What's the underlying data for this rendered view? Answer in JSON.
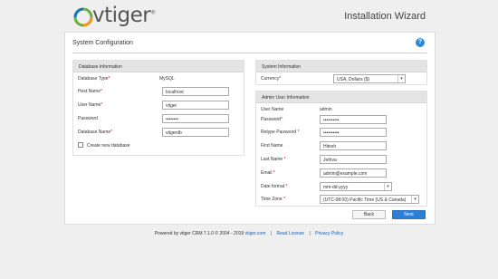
{
  "brand": {
    "name": "vtiger",
    "trademark": "®"
  },
  "header": {
    "wizard_title": "Installation Wizard"
  },
  "page": {
    "title": "System Configuration",
    "help_icon": "help-icon"
  },
  "database": {
    "heading": "Database Information",
    "fields": [
      {
        "label": "Database Type",
        "required": "*",
        "value": "MySQL"
      },
      {
        "label": "Host Name",
        "required": "*",
        "value": "localhost"
      },
      {
        "label": "User Name",
        "required": "*",
        "value": "vtiger"
      },
      {
        "label": "Password",
        "required": "",
        "value": "••••••••"
      },
      {
        "label": "Database Name",
        "required": "*",
        "value": "vtigerdb"
      }
    ],
    "create_new_label": "Create new database"
  },
  "system": {
    "heading": "System Information",
    "currency_label": "Currency",
    "currency_required": "*",
    "currency_value": "USA, Dollars ($)"
  },
  "admin": {
    "heading": "Admin User Information",
    "fields": [
      {
        "label": "User Name",
        "required": "",
        "value": "admin"
      },
      {
        "label": "Password",
        "required": "*",
        "value": "••••••••••"
      },
      {
        "label": "Retype Password",
        "required": "*",
        "value": "••••••••••"
      },
      {
        "label": "First Name",
        "required": "",
        "value": "Hitesh"
      },
      {
        "label": "Last Name",
        "required": "*",
        "value": "Jethva"
      },
      {
        "label": "Email",
        "required": "*",
        "value": "admin@example.com"
      },
      {
        "label": "Date format",
        "required": "*",
        "value": "mm-dd-yyyy"
      },
      {
        "label": "Time Zone",
        "required": "*",
        "value": "(UTC-08:00) Pacific Time (US & Canada)"
      }
    ]
  },
  "buttons": {
    "back": "Back",
    "next": "Next"
  },
  "footer": {
    "powered_by": "Powered by vtiger CRM 7.1.0  © 2004 - 2019",
    "site_link": "vtiger.com",
    "read_license": "Read License",
    "privacy_policy": "Privacy Policy",
    "separator": "|"
  },
  "colors": {
    "accent": "#2d7fd6",
    "required": "#dd0000",
    "panel_header": "#e4e4e4"
  }
}
